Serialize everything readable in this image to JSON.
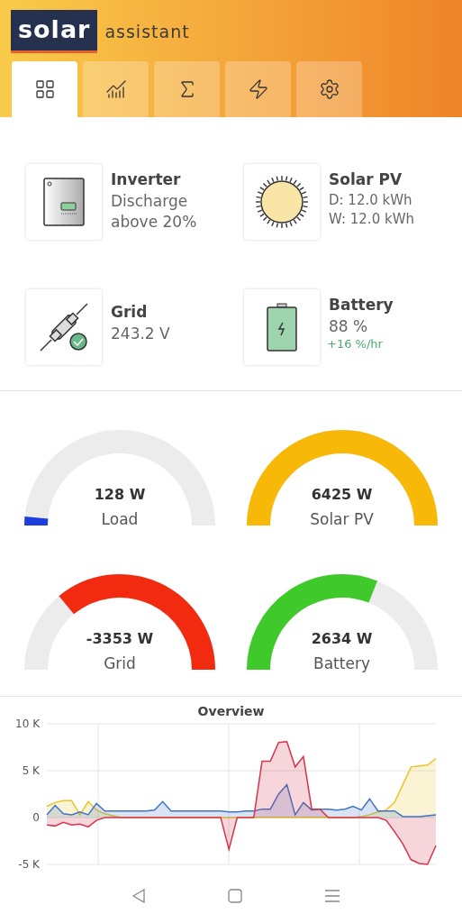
{
  "logo": {
    "brand": "solar",
    "suffix": "assistant"
  },
  "tabs": [
    {
      "kind": "dashboard",
      "selected": true
    },
    {
      "kind": "charts",
      "selected": false
    },
    {
      "kind": "totals",
      "selected": false
    },
    {
      "kind": "power",
      "selected": false
    },
    {
      "kind": "settings",
      "selected": false
    }
  ],
  "devices": [
    {
      "kind": "inverter",
      "title": "Inverter",
      "lines": [
        "Discharge",
        "above 20%"
      ]
    },
    {
      "kind": "solar",
      "title": "Solar PV",
      "lines": [
        "D: 12.0 kWh",
        "W: 12.0 kWh"
      ]
    },
    {
      "kind": "grid",
      "title": "Grid",
      "lines": [
        "243.2 V"
      ]
    },
    {
      "kind": "battery",
      "title": "Battery",
      "lines": [
        "88 %"
      ],
      "rate": "+16 %/hr"
    }
  ],
  "gauges": [
    {
      "value": "128 W",
      "label": "Load",
      "color": "#1f3ee0"
    },
    {
      "value": "6425 W",
      "label": "Solar PV",
      "color": "#f8b808"
    },
    {
      "value": "-3353 W",
      "label": "Grid",
      "color": "#f22a10"
    },
    {
      "value": "2634 W",
      "label": "Battery",
      "color": "#3fc92a"
    }
  ],
  "overview": {
    "title": "Overview",
    "chart_data": {
      "type": "area",
      "grid": true,
      "ylim": [
        -5000,
        10000
      ],
      "yticks": [
        {
          "value": -5000,
          "label": "-5 K"
        },
        {
          "value": 0,
          "label": "0"
        },
        {
          "value": 5000,
          "label": "5 K"
        },
        {
          "value": 10000,
          "label": "10 K"
        }
      ],
      "series": [
        {
          "color": "#e8c62a",
          "values": [
            1200,
            1600,
            1800,
            1800,
            300,
            1700,
            800,
            400,
            200,
            0,
            0,
            0,
            0,
            0,
            0,
            0,
            0,
            0,
            0,
            0,
            0,
            0,
            0,
            0,
            0,
            0,
            0,
            0,
            0,
            0,
            0,
            0,
            0,
            0,
            0,
            0,
            0,
            0,
            100,
            300,
            600,
            800,
            1600,
            3500,
            5400,
            5500,
            5600,
            6300
          ]
        },
        {
          "color": "#3f74c9",
          "values": [
            300,
            1300,
            400,
            300,
            600,
            300,
            1500,
            700,
            700,
            700,
            700,
            700,
            700,
            800,
            1700,
            700,
            700,
            700,
            700,
            700,
            700,
            700,
            600,
            600,
            700,
            700,
            900,
            900,
            2500,
            3500,
            300,
            1600,
            800,
            900,
            900,
            800,
            900,
            1200,
            800,
            2000,
            700,
            700,
            700,
            100,
            100,
            100,
            200,
            300
          ]
        },
        {
          "color": "#d6344a",
          "values": [
            -800,
            -900,
            -500,
            -800,
            -700,
            -1000,
            -300,
            0,
            0,
            0,
            0,
            0,
            0,
            0,
            0,
            0,
            0,
            0,
            0,
            0,
            0,
            0,
            -3400,
            0,
            0,
            0,
            6000,
            6000,
            8000,
            8100,
            5400,
            6500,
            900,
            900,
            0,
            0,
            0,
            0,
            0,
            0,
            0,
            -300,
            -1500,
            -2800,
            -4500,
            -4900,
            -5000,
            -3000
          ]
        }
      ]
    }
  },
  "nav": [
    {
      "kind": "back"
    },
    {
      "kind": "home"
    },
    {
      "kind": "recents"
    }
  ]
}
